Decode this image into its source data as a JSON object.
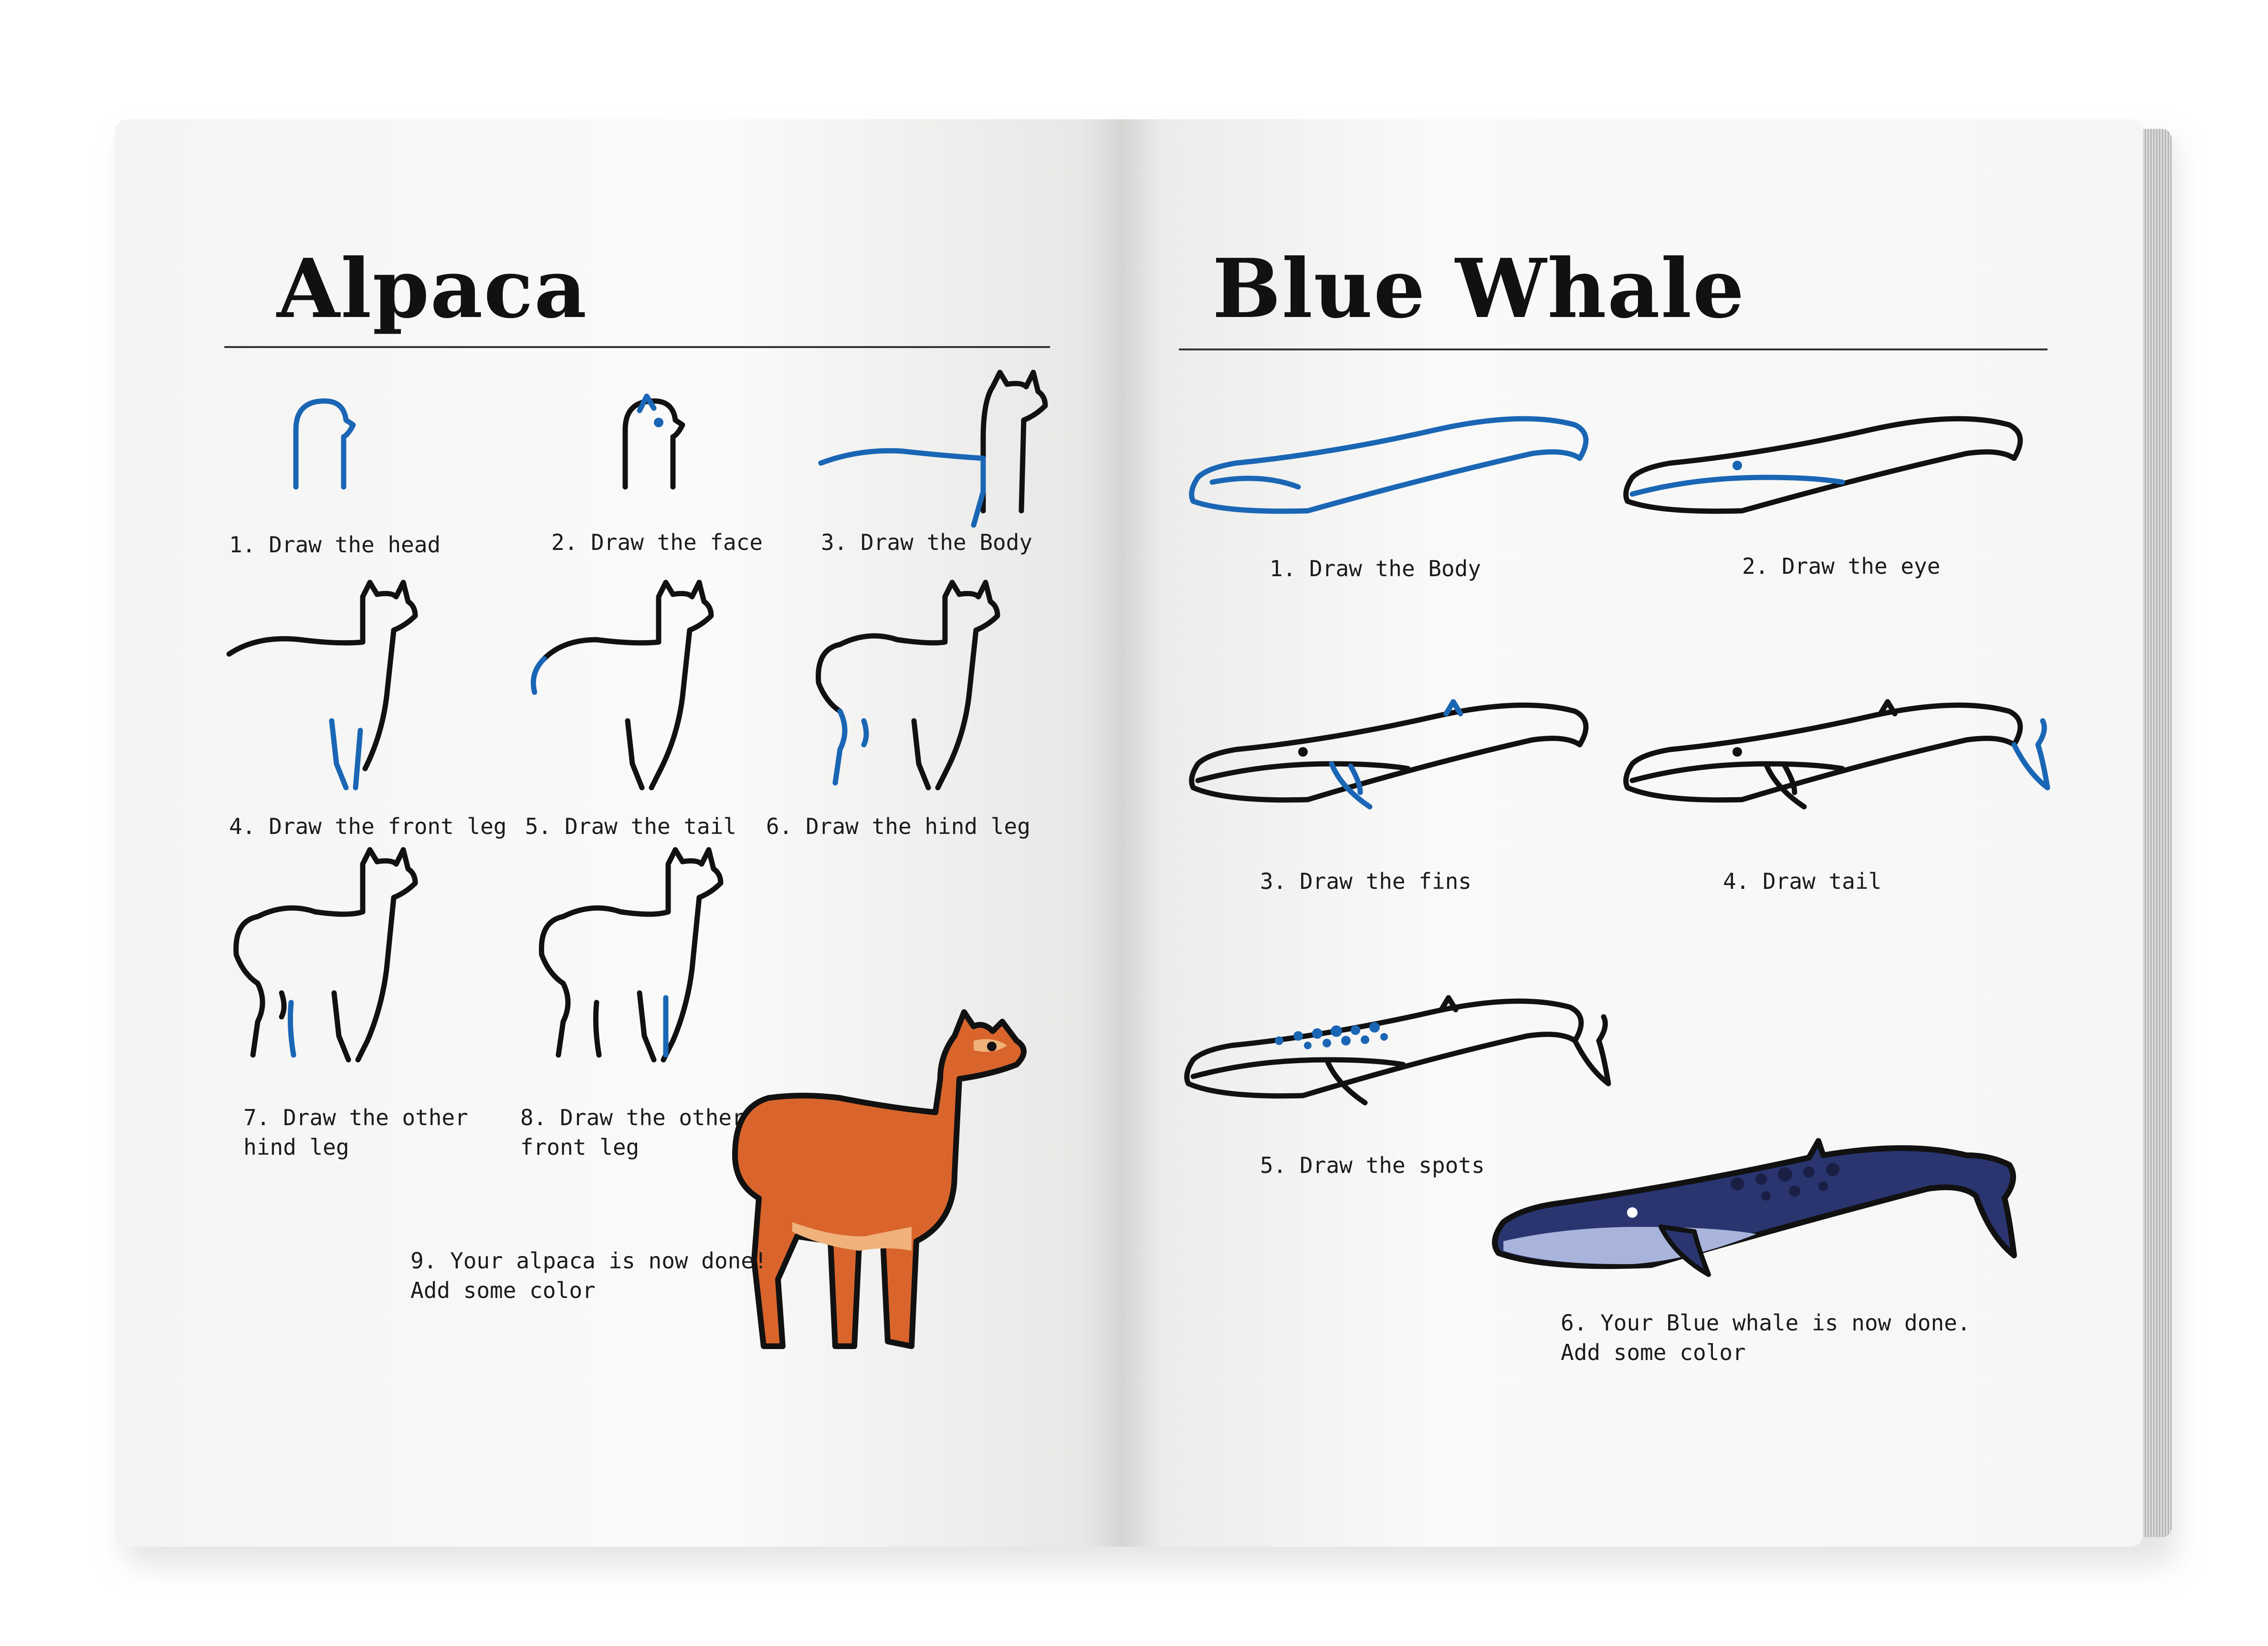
{
  "left_page": {
    "title": "Alpaca",
    "steps": [
      {
        "text": "1. Draw the head"
      },
      {
        "text": "2. Draw the face"
      },
      {
        "text": "3. Draw the Body"
      },
      {
        "text": "4. Draw the front leg"
      },
      {
        "text": "5. Draw the tail"
      },
      {
        "text": "6. Draw the hind leg"
      },
      {
        "text": "7. Draw the other\nhind leg"
      },
      {
        "text": "8. Draw the other\nfront leg"
      },
      {
        "text": "9. Your alpaca is now done!\nAdd some color"
      }
    ]
  },
  "right_page": {
    "title": "Blue Whale",
    "steps": [
      {
        "text": "1. Draw the Body"
      },
      {
        "text": "2. Draw the eye"
      },
      {
        "text": "3. Draw the fins"
      },
      {
        "text": "4. Draw tail"
      },
      {
        "text": "5. Draw the spots"
      },
      {
        "text": "6. Your Blue whale is now done.\nAdd some color"
      }
    ]
  },
  "colors": {
    "ink": "#111111",
    "step_highlight": "#1a66b5",
    "alpaca_fur": "#d9652c",
    "alpaca_light": "#f0b27a",
    "whale_body": "#2a3570",
    "whale_belly": "#a8b4dc"
  }
}
